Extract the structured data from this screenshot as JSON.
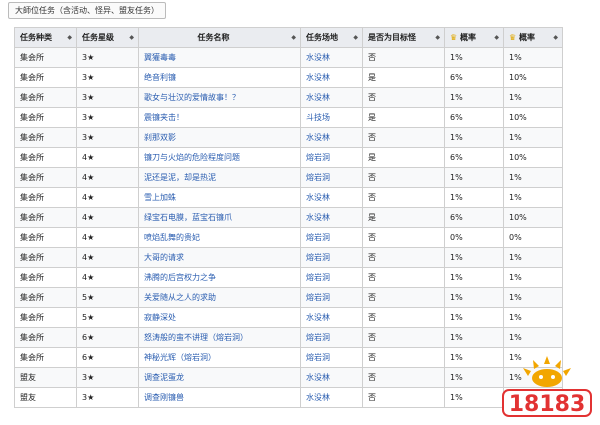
{
  "caption": "大師位任务（含活动、怪异、盟友任务）",
  "headers": [
    "任务种类",
    "任务星级",
    "任务名称",
    "任务场地",
    "是否为目标怪",
    "概率",
    "概率"
  ],
  "rows": [
    [
      "集会所",
      "3★",
      "翼獾毒毒",
      "水没林",
      "否",
      "1%",
      "1%"
    ],
    [
      "集会所",
      "3★",
      "绝音利镰",
      "水没林",
      "是",
      "6%",
      "10%"
    ],
    [
      "集会所",
      "3★",
      "歌女与壮汉的爱情故事！？",
      "水没林",
      "否",
      "1%",
      "1%"
    ],
    [
      "集会所",
      "3★",
      "震镰夹击！",
      "斗技场",
      "是",
      "6%",
      "10%"
    ],
    [
      "集会所",
      "3★",
      "刹那双影",
      "水没林",
      "否",
      "1%",
      "1%"
    ],
    [
      "集会所",
      "4★",
      "镰刀与火焰的危险程度问题",
      "熔岩洞",
      "是",
      "6%",
      "10%"
    ],
    [
      "集会所",
      "4★",
      "泥还是泥，却是热泥",
      "熔岩洞",
      "否",
      "1%",
      "1%"
    ],
    [
      "集会所",
      "4★",
      "雪上加蛛",
      "水没林",
      "否",
      "1%",
      "1%"
    ],
    [
      "集会所",
      "4★",
      "绿宝石电膜，蓝宝石镰爪",
      "水没林",
      "是",
      "6%",
      "10%"
    ],
    [
      "集会所",
      "4★",
      "喷焰乱舞的贵妃",
      "熔岩洞",
      "否",
      "0%",
      "0%"
    ],
    [
      "集会所",
      "4★",
      "大哥的请求",
      "熔岩洞",
      "否",
      "1%",
      "1%"
    ],
    [
      "集会所",
      "4★",
      "沸腾的后宫权力之争",
      "熔岩洞",
      "否",
      "1%",
      "1%"
    ],
    [
      "集会所",
      "5★",
      "关爱随从之人的求助",
      "熔岩洞",
      "否",
      "1%",
      "1%"
    ],
    [
      "集会所",
      "5★",
      "寂静深处",
      "水没林",
      "否",
      "1%",
      "1%"
    ],
    [
      "集会所",
      "6★",
      "怒涛般的蛮不讲理（熔岩洞）",
      "熔岩洞",
      "否",
      "1%",
      "1%"
    ],
    [
      "集会所",
      "6★",
      "神秘光辉（熔岩洞）",
      "熔岩洞",
      "否",
      "1%",
      "1%"
    ],
    [
      "盟友",
      "3★",
      "调查泥蛋龙",
      "水没林",
      "否",
      "1%",
      "1%"
    ],
    [
      "盟友",
      "3★",
      "调查刚镰兽",
      "水没林",
      "否",
      "1%",
      "1%"
    ]
  ],
  "logo_text": "18183",
  "icons": {
    "sort": "sort-arrows-icon",
    "crown": "crown-icon"
  }
}
